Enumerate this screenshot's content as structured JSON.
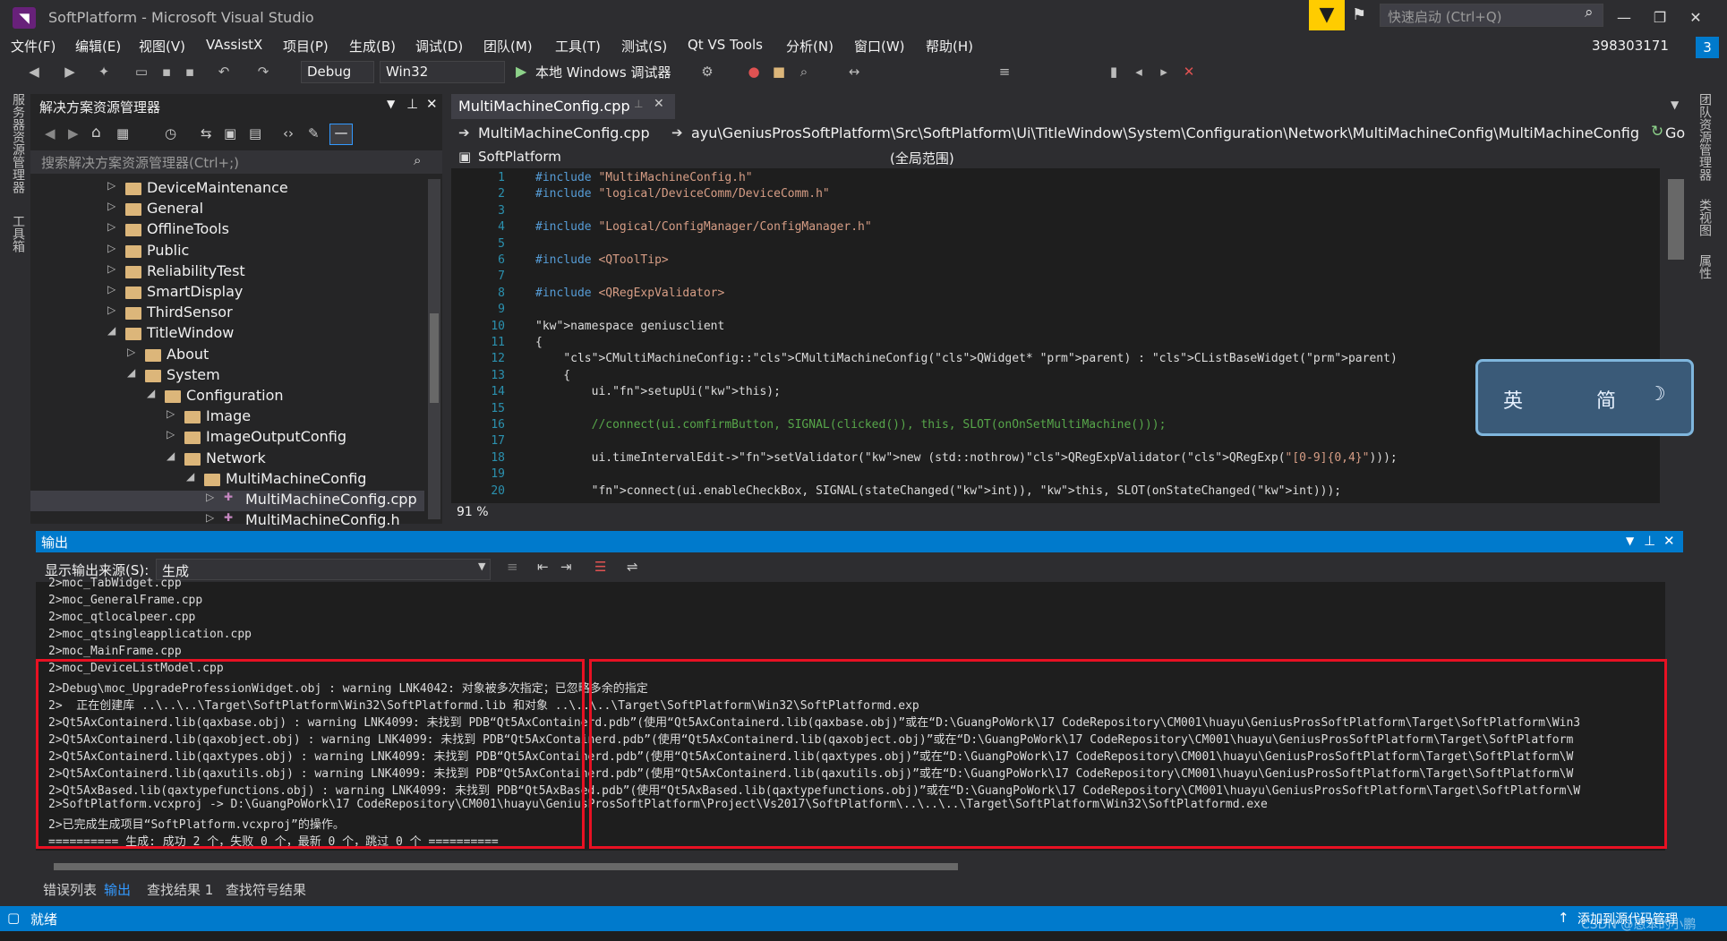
{
  "window": {
    "title": "SoftPlatform - Microsoft Visual Studio",
    "quick_launch_placeholder": "快速启动 (Ctrl+Q)",
    "account": "398303171",
    "notifications": "3"
  },
  "menu": [
    "文件(F)",
    "编辑(E)",
    "视图(V)",
    "VAssistX",
    "项目(P)",
    "生成(B)",
    "调试(D)",
    "团队(M)",
    "工具(T)",
    "测试(S)",
    "Qt VS Tools",
    "分析(N)",
    "窗口(W)",
    "帮助(H)"
  ],
  "toolbar": {
    "config": "Debug",
    "platform": "Win32",
    "run_label": "本地 Windows 调试器"
  },
  "left_strip": [
    "服务器资源管理器",
    "工具箱"
  ],
  "right_strip": [
    "团队资源管理器",
    "类视图",
    "属性"
  ],
  "solution_explorer": {
    "title": "解决方案资源管理器",
    "search_placeholder": "搜索解决方案资源管理器(Ctrl+;)",
    "items": [
      {
        "label": "DeviceMaintenance",
        "depth": 0,
        "expanded": false
      },
      {
        "label": "General",
        "depth": 0,
        "expanded": false
      },
      {
        "label": "OfflineTools",
        "depth": 0,
        "expanded": false
      },
      {
        "label": "Public",
        "depth": 0,
        "expanded": false
      },
      {
        "label": "ReliabilityTest",
        "depth": 0,
        "expanded": false
      },
      {
        "label": "SmartDisplay",
        "depth": 0,
        "expanded": false
      },
      {
        "label": "ThirdSensor",
        "depth": 0,
        "expanded": false
      },
      {
        "label": "TitleWindow",
        "depth": 0,
        "expanded": true
      },
      {
        "label": "About",
        "depth": 1,
        "expanded": false
      },
      {
        "label": "System",
        "depth": 1,
        "expanded": true
      },
      {
        "label": "Configuration",
        "depth": 2,
        "expanded": true
      },
      {
        "label": "Image",
        "depth": 3,
        "expanded": false
      },
      {
        "label": "ImageOutputConfig",
        "depth": 3,
        "expanded": false
      },
      {
        "label": "Network",
        "depth": 3,
        "expanded": true
      },
      {
        "label": "MultiMachineConfig",
        "depth": 4,
        "expanded": true
      },
      {
        "label": "MultiMachineConfig.cpp",
        "depth": 5,
        "expanded": false,
        "selected": true
      },
      {
        "label": "MultiMachineConfig.h",
        "depth": 5,
        "expanded": false
      }
    ]
  },
  "editor": {
    "tab": "MultiMachineConfig.cpp",
    "nav_file": "MultiMachineConfig.cpp",
    "nav_path": "ayu\\GeniusProsSoftPlatform\\Src\\SoftPlatform\\Ui\\TitleWindow\\System\\Configuration\\Network\\MultiMachineConfig\\MultiMachineConfig.cpp",
    "nav_go": "Go",
    "scope_project": "SoftPlatform",
    "scope": "(全局范围)",
    "zoom": "91 %",
    "line_numbers": [
      "1",
      "2",
      "3",
      "4",
      "5",
      "6",
      "7",
      "8",
      "9",
      "10",
      "11",
      "12",
      "13",
      "14",
      "15",
      "16",
      "17",
      "18",
      "19",
      "20"
    ],
    "lines": [
      "#include \"MultiMachineConfig.h\"",
      "#include \"logical/DeviceComm/DeviceComm.h\"",
      "",
      "#include \"Logical/ConfigManager/ConfigManager.h\"",
      "",
      "#include <QToolTip>",
      "",
      "#include <QRegExpValidator>",
      "",
      "namespace geniusclient",
      "{",
      "    CMultiMachineConfig::CMultiMachineConfig(QWidget* parent) : CListBaseWidget(parent)",
      "    {",
      "        ui.setupUi(this);",
      "",
      "        //connect(ui.comfirmButton, SIGNAL(clicked()), this, SLOT(onOnSetMultiMachine()));",
      "",
      "        ui.timeIntervalEdit->setValidator(new (std::nothrow)QRegExpValidator(QRegExp(\"[0-9]{0,4}\")));",
      "",
      "        connect(ui.enableCheckBox, SIGNAL(stateChanged(int)), this, SLOT(onStateChanged(int)));"
    ]
  },
  "ime": {
    "left": "英",
    "right": "简"
  },
  "output": {
    "title": "输出",
    "source_label": "显示输出来源(S):",
    "source_value": "生成",
    "lines": [
      "2>moc_TabWidget.cpp",
      "2>moc_GeneralFrame.cpp",
      "2>moc_qtlocalpeer.cpp",
      "2>moc_qtsingleapplication.cpp",
      "2>moc_MainFrame.cpp",
      "2>moc_DeviceListModel.cpp",
      "2>Debug\\moc_UpgradeProfessionWidget.obj : warning LNK4042: 对象被多次指定；已忽略多余的指定",
      "2>  正在创建库 ..\\..\\..\\Target\\SoftPlatform\\Win32\\SoftPlatformd.lib 和对象 ..\\..\\..\\Target\\SoftPlatform\\Win32\\SoftPlatformd.exp",
      "2>Qt5AxContainerd.lib(qaxbase.obj) : warning LNK4099: 未找到 PDB“Qt5AxContainerd.pdb”(使用“Qt5AxContainerd.lib(qaxbase.obj)”或在“D:\\GuangPoWork\\17 CodeRepository\\CM001\\huayu\\GeniusProsSoftPlatform\\Target\\SoftPlatform\\Win3",
      "2>Qt5AxContainerd.lib(qaxobject.obj) : warning LNK4099: 未找到 PDB“Qt5AxContainerd.pdb”(使用“Qt5AxContainerd.lib(qaxobject.obj)”或在“D:\\GuangPoWork\\17 CodeRepository\\CM001\\huayu\\GeniusProsSoftPlatform\\Target\\SoftPlatform",
      "2>Qt5AxContainerd.lib(qaxtypes.obj) : warning LNK4099: 未找到 PDB“Qt5AxContainerd.pdb”(使用“Qt5AxContainerd.lib(qaxtypes.obj)”或在“D:\\GuangPoWork\\17 CodeRepository\\CM001\\huayu\\GeniusProsSoftPlatform\\Target\\SoftPlatform\\W",
      "2>Qt5AxContainerd.lib(qaxutils.obj) : warning LNK4099: 未找到 PDB“Qt5AxContainerd.pdb”(使用“Qt5AxContainerd.lib(qaxutils.obj)”或在“D:\\GuangPoWork\\17 CodeRepository\\CM001\\huayu\\GeniusProsSoftPlatform\\Target\\SoftPlatform\\W",
      "2>Qt5AxBased.lib(qaxtypefunctions.obj) : warning LNK4099: 未找到 PDB“Qt5AxBased.pdb”(使用“Qt5AxBased.lib(qaxtypefunctions.obj)”或在“D:\\GuangPoWork\\17 CodeRepository\\CM001\\huayu\\GeniusProsSoftPlatform\\Target\\SoftPlatform\\W",
      "2>SoftPlatform.vcxproj -> D:\\GuangPoWork\\17 CodeRepository\\CM001\\huayu\\GeniusProsSoftPlatform\\Project\\Vs2017\\SoftPlatform\\..\\..\\..\\Target\\SoftPlatform\\Win32\\SoftPlatformd.exe",
      "2>已完成生成项目“SoftPlatform.vcxproj”的操作。",
      "========== 生成: 成功 2 个，失败 0 个，最新 0 个，跳过 0 个 =========="
    ]
  },
  "bottom_tabs": [
    "错误列表",
    "输出",
    "查找结果 1",
    "查找符号结果"
  ],
  "status": {
    "left": "就绪",
    "right": "添加到源代码管理",
    "watermark": "CSDN @愚笨的小鹏"
  },
  "colors": {
    "accent": "#007acc",
    "highlight_box": "#e81123",
    "filter_icon": "#ffcc00"
  }
}
